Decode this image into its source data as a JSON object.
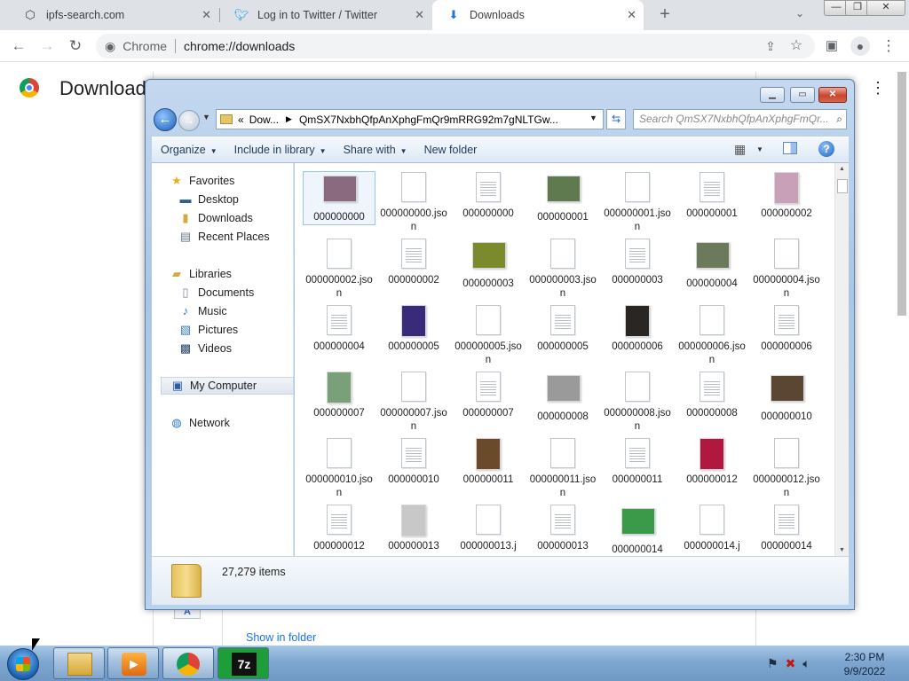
{
  "browser": {
    "tabs": [
      {
        "title": "ipfs-search.com",
        "icon": "ipfs-icon",
        "active": false
      },
      {
        "title": "Log in to Twitter / Twitter",
        "icon": "twitter-icon",
        "active": false
      },
      {
        "title": "Downloads",
        "icon": "download-icon",
        "active": true
      }
    ],
    "omnibox": {
      "chip": "Chrome",
      "url": "chrome://downloads"
    }
  },
  "downloads_page": {
    "title": "Downloads",
    "show_in_folder": "Show in folder",
    "file_icon_letter": "A"
  },
  "explorer": {
    "breadcrumb": {
      "chev": "«",
      "root": "Dow...",
      "folder": "QmSX7NxbhQfpAnXphgFmQr9mRRG92m7gNLTGw..."
    },
    "search_placeholder": "Search QmSX7NxbhQfpAnXphgFmQr...",
    "commands": [
      "Organize",
      "Include in library",
      "Share with",
      "New folder"
    ],
    "nav": {
      "favorites": "Favorites",
      "desktop": "Desktop",
      "downloads": "Downloads",
      "recent": "Recent Places",
      "libraries": "Libraries",
      "documents": "Documents",
      "music": "Music",
      "pictures": "Pictures",
      "videos": "Videos",
      "my_computer": "My Computer",
      "network": "Network"
    },
    "files": [
      {
        "name": "000000000",
        "type": "image",
        "color": "#8a6a7e"
      },
      {
        "name": "000000000.json",
        "type": "blank"
      },
      {
        "name": "000000000",
        "type": "doc"
      },
      {
        "name": "000000001",
        "type": "image",
        "color": "#5e7a4e"
      },
      {
        "name": "000000001.json",
        "type": "blank"
      },
      {
        "name": "000000001",
        "type": "doc"
      },
      {
        "name": "000000002",
        "type": "image-tall",
        "color": "#c8a0b8"
      },
      {
        "name": "000000002.json",
        "type": "blank"
      },
      {
        "name": "000000002",
        "type": "doc"
      },
      {
        "name": "000000003",
        "type": "image",
        "color": "#7c8a2e"
      },
      {
        "name": "000000003.json",
        "type": "blank"
      },
      {
        "name": "000000003",
        "type": "doc"
      },
      {
        "name": "000000004",
        "type": "image",
        "color": "#6a7a5a"
      },
      {
        "name": "000000004.json",
        "type": "blank"
      },
      {
        "name": "000000004",
        "type": "doc"
      },
      {
        "name": "000000005",
        "type": "image-tall",
        "color": "#3a2a7a"
      },
      {
        "name": "000000005.json",
        "type": "blank"
      },
      {
        "name": "000000005",
        "type": "doc"
      },
      {
        "name": "000000006",
        "type": "image-tall",
        "color": "#2a2624"
      },
      {
        "name": "000000006.json",
        "type": "blank"
      },
      {
        "name": "000000006",
        "type": "doc"
      },
      {
        "name": "000000007",
        "type": "image-tall",
        "color": "#7aa07a"
      },
      {
        "name": "000000007.json",
        "type": "blank"
      },
      {
        "name": "000000007",
        "type": "doc"
      },
      {
        "name": "000000008",
        "type": "image",
        "color": "#9a9a9a"
      },
      {
        "name": "000000008.json",
        "type": "blank"
      },
      {
        "name": "000000008",
        "type": "doc"
      },
      {
        "name": "000000010",
        "type": "image",
        "color": "#5a4632"
      },
      {
        "name": "000000010.json",
        "type": "blank"
      },
      {
        "name": "000000010",
        "type": "doc"
      },
      {
        "name": "000000011",
        "type": "image-tall",
        "color": "#6a4a2a"
      },
      {
        "name": "000000011.json",
        "type": "blank"
      },
      {
        "name": "000000011",
        "type": "doc"
      },
      {
        "name": "000000012",
        "type": "image-tall",
        "color": "#b01840"
      },
      {
        "name": "000000012.json",
        "type": "blank"
      },
      {
        "name": "000000012",
        "type": "doc"
      },
      {
        "name": "000000013",
        "type": "image-tall",
        "color": "#c8c8c8"
      },
      {
        "name": "000000013.j",
        "type": "blank"
      },
      {
        "name": "000000013",
        "type": "doc"
      },
      {
        "name": "000000014",
        "type": "image",
        "color": "#3a9a4a"
      },
      {
        "name": "000000014.j",
        "type": "blank"
      },
      {
        "name": "000000014",
        "type": "doc"
      }
    ],
    "item_count": "27,279 items"
  },
  "taskbar": {
    "clock_time": "2:30 PM",
    "clock_date": "9/9/2022",
    "seven_zip": "7z"
  }
}
